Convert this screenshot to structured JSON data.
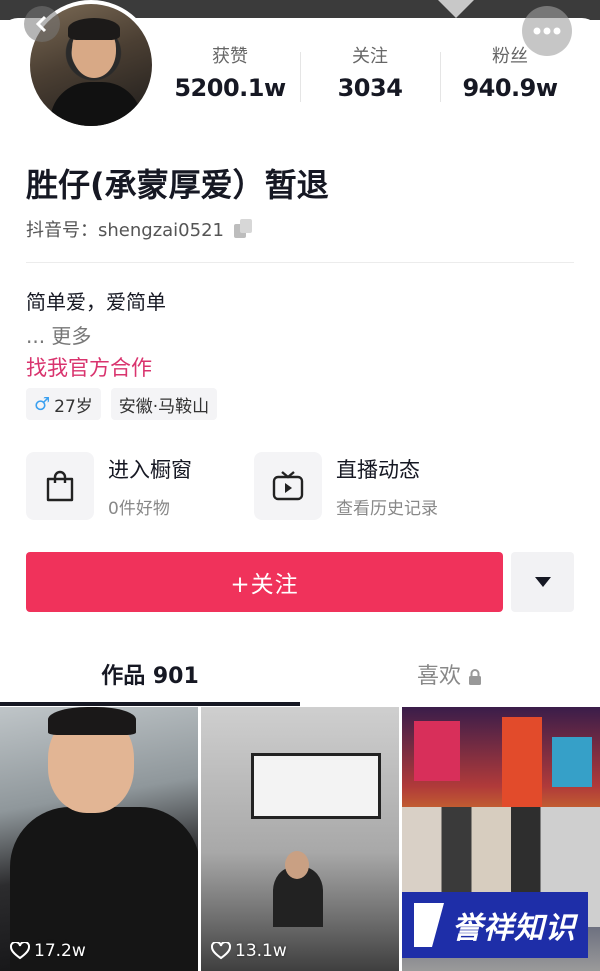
{
  "profile": {
    "name": "胜仔(承蒙厚爱）暂退",
    "uid_label": "抖音号：",
    "uid": "shengzai0521"
  },
  "stats": [
    {
      "label": "获赞",
      "value": "5200.1w"
    },
    {
      "label": "关注",
      "value": "3034"
    },
    {
      "label": "粉丝",
      "value": "940.9w"
    }
  ],
  "bio": {
    "text": "简单爱，爱简单",
    "more": "... 更多",
    "cooperation": "找我官方合作"
  },
  "tags": {
    "age": "27岁",
    "location": "安徽·马鞍山"
  },
  "features": [
    {
      "title": "进入橱窗",
      "subtitle": "0件好物",
      "icon": "shopping-bag-icon"
    },
    {
      "title": "直播动态",
      "subtitle": "查看历史记录",
      "icon": "tv-play-icon"
    }
  ],
  "actions": {
    "follow_label": "+关注"
  },
  "tabs": [
    {
      "label": "作品 901"
    },
    {
      "label": "喜欢"
    }
  ],
  "videos": [
    {
      "likes": "17.2w"
    },
    {
      "likes": "13.1w"
    }
  ],
  "watermark": {
    "text": "誉祥知识"
  },
  "colors": {
    "accent": "#f0325b",
    "link": "#d9346e",
    "watermark_bg": "#1e2ea8"
  }
}
